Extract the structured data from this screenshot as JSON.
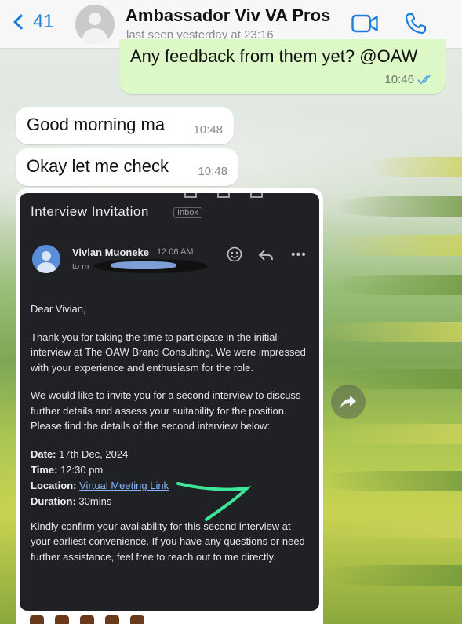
{
  "header": {
    "back_count": "41",
    "contact_name": "Ambassador Viv VA Pros",
    "status": "last seen yesterday at 23:16"
  },
  "messages": [
    {
      "direction": "outgoing",
      "text": "Any feedback from them yet? @OAW",
      "time": "10:46",
      "read": true
    },
    {
      "direction": "incoming",
      "text": "Good morning ma",
      "time": "10:48"
    },
    {
      "direction": "incoming",
      "text": "Okay let me check",
      "time": "10:48"
    }
  ],
  "email": {
    "subject": "Interview Invitation",
    "tag": "Inbox",
    "sender": "Vivian Muoneke",
    "sent_time": "12:06 AM",
    "to_prefix": "to m",
    "greeting": "Dear Vivian,",
    "para1": "Thank you for taking the time to participate in the initial interview at The OAW Brand Consulting. We were impressed with your experience and enthusiasm for the role.",
    "para2": "We would like to invite you for a second interview to discuss further details and assess your suitability for the position. Please find the details of the second interview below:",
    "details": {
      "date_label": "Date:",
      "date_value": "17th Dec, 2024",
      "time_label": "Time:",
      "time_value": "12:30 pm",
      "location_label": "Location:",
      "location_value": "Virtual Meeting Link",
      "duration_label": "Duration:",
      "duration_value": "30mins"
    },
    "para3": "Kindly confirm your availability for this second interview at your earliest convenience. If you have any questions or need further assistance, feel free to reach out to me directly."
  },
  "colors": {
    "accent": "#1a7dde",
    "outgoing_bubble": "#dcf8c6",
    "email_bg": "#202124",
    "link": "#8ab4f8",
    "scribble": "#3ee69a"
  },
  "icons": [
    "chevron-left-icon",
    "avatar-icon",
    "video-call-icon",
    "phone-icon",
    "read-ticks-icon",
    "emoji-icon",
    "reply-icon",
    "more-icon",
    "forward-icon"
  ]
}
